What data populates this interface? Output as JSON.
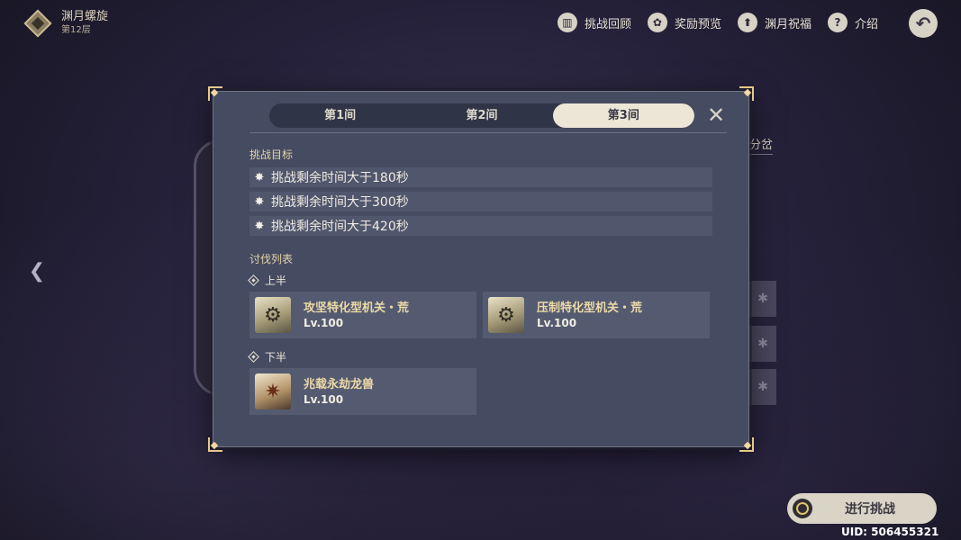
{
  "header": {
    "floor_title": "渊月螺旋",
    "floor_sub": "第12层"
  },
  "top_menu": [
    {
      "label": "挑战回顾",
      "icon": "book-icon",
      "glyph": "▥"
    },
    {
      "label": "奖励预览",
      "icon": "gear-flower-icon",
      "glyph": "✿"
    },
    {
      "label": "渊月祝福",
      "icon": "upgrade-arrow-icon",
      "glyph": "⬆"
    },
    {
      "label": "介绍",
      "icon": "question-icon",
      "glyph": "?"
    }
  ],
  "back_glyph": "↶",
  "background": {
    "peek_text": "分岔"
  },
  "modal": {
    "tabs": [
      "第1间",
      "第2间",
      "第3间"
    ],
    "active_tab": 2,
    "close_glyph": "✕",
    "goals_title": "挑战目标",
    "goals": [
      "挑战剩余时间大于180秒",
      "挑战剩余时间大于300秒",
      "挑战剩余时间大于420秒"
    ],
    "enemies_title": "讨伐列表",
    "first_half_label": "上半",
    "second_half_label": "下半",
    "first_half_enemies": [
      {
        "name": "攻坚特化型机关・荒",
        "level": "Lv.100"
      },
      {
        "name": "压制特化型机关・荒",
        "level": "Lv.100"
      }
    ],
    "second_half_enemies": [
      {
        "name": "兆载永劫龙兽",
        "level": "Lv.100"
      }
    ]
  },
  "challenge_button": "进行挑战",
  "uid": "UID: 506455321",
  "colors": {
    "accent_gold": "#e3d3a8",
    "modal_bg": "#454b61",
    "active_tab_bg": "#ece6d6"
  }
}
